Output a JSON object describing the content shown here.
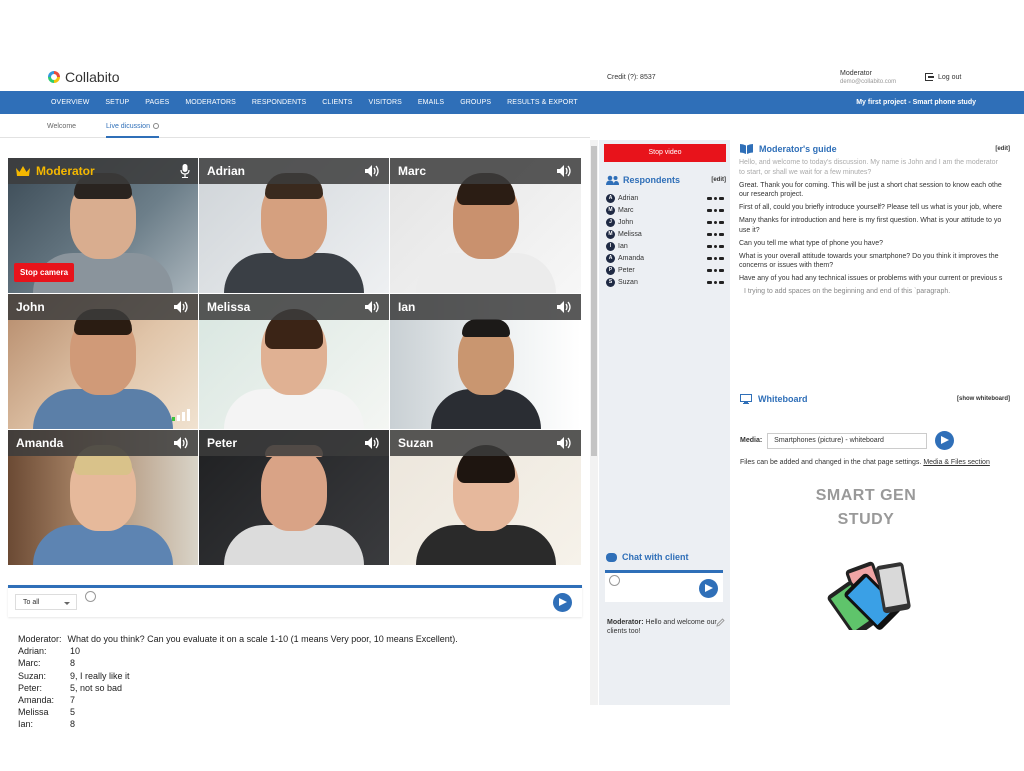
{
  "app": {
    "logo_text": "Collabito",
    "credit": "Credit (?):  8537",
    "user_name": "Moderator",
    "user_email": "demo@collabito.com",
    "logout_label": "Log out"
  },
  "nav": {
    "items": [
      "OVERVIEW",
      "SETUP",
      "PAGES",
      "MODERATORS",
      "RESPONDENTS",
      "CLIENTS",
      "VISITORS",
      "EMAILS",
      "GROUPS",
      "RESULTS & EXPORT"
    ],
    "project": "My first project - Smart phone study"
  },
  "subtabs": {
    "welcome": "Welcome",
    "live": "Live dicussion"
  },
  "video": {
    "stop_camera_label": "Stop camera",
    "tiles": [
      {
        "name": "Moderator"
      },
      {
        "name": "Adrian"
      },
      {
        "name": "Marc"
      },
      {
        "name": "John"
      },
      {
        "name": "Melissa"
      },
      {
        "name": "Ian"
      },
      {
        "name": "Amanda"
      },
      {
        "name": "Peter"
      },
      {
        "name": "Suzan"
      }
    ]
  },
  "chat_input": {
    "recipient": "To all"
  },
  "chat_log": [
    {
      "who": "Moderator:",
      "msg": "What do you think? Can you evaluate it on a scale 1-10 (1 means Very poor, 10 means Excellent)."
    },
    {
      "who": "Adrian:",
      "msg": "10"
    },
    {
      "who": "Marc:",
      "msg": "8"
    },
    {
      "who": "Suzan:",
      "msg": "9, I really like it"
    },
    {
      "who": "Peter:",
      "msg": "5, not so bad"
    },
    {
      "who": "Amanda:",
      "msg": "7"
    },
    {
      "who": "Melissa",
      "msg": "5"
    },
    {
      "who": "Ian:",
      "msg": "8"
    }
  ],
  "middle": {
    "stop_video_label": "Stop video",
    "respondents_title": "Respondents",
    "edit_label": "[edit]",
    "respondents": [
      {
        "initial": "A",
        "name": "Adrian"
      },
      {
        "initial": "M",
        "name": "Marc"
      },
      {
        "initial": "J",
        "name": "John"
      },
      {
        "initial": "M",
        "name": "Melissa"
      },
      {
        "initial": "I",
        "name": "Ian"
      },
      {
        "initial": "A",
        "name": "Amanda"
      },
      {
        "initial": "P",
        "name": "Peter"
      },
      {
        "initial": "S",
        "name": "Suzan"
      }
    ],
    "chat_client_title": "Chat with client",
    "client_msg_who": "Moderator:",
    "client_msg_text": "Hello and welcome our clients too!"
  },
  "guide": {
    "title": "Moderator's guide",
    "edit_label": "[edit]",
    "lines": [
      "Hello, and welcome to today's discussion. My name is John and I am the moderator",
      "to start, or shall we wait for a few minutes?",
      "Great. Thank you for coming. This will be just a short chat session to know each othe",
      "our research project.",
      "First of all, could you briefly introduce yourself? Please tell us what is your job, where",
      "Many thanks for introduction and here is my first question. What is your attitude to yo",
      "use it?",
      "Can you tell me what type of phone you have?",
      "What is your overall attitude towards your smartphone? Do you think it improves the",
      "concerns or issues with them?",
      "Have any of you had any technical issues or problems with your current or previous s",
      "I trying to add spaces on the beginning and end of this `paragraph."
    ]
  },
  "whiteboard": {
    "title": "Whiteboard",
    "show_label": "[show whiteboard]",
    "media_label": "Media:",
    "media_value": "Smartphones (picture) - whiteboard",
    "files_note": "Files can be added and changed in the chat page settings.",
    "files_link": "Media & Files section",
    "board_line1": "SMART GEN",
    "board_line2": "STUDY"
  },
  "colors": {
    "accent": "#2f6fb8",
    "danger": "#e8131b",
    "moderator_gold": "#f5b800"
  }
}
